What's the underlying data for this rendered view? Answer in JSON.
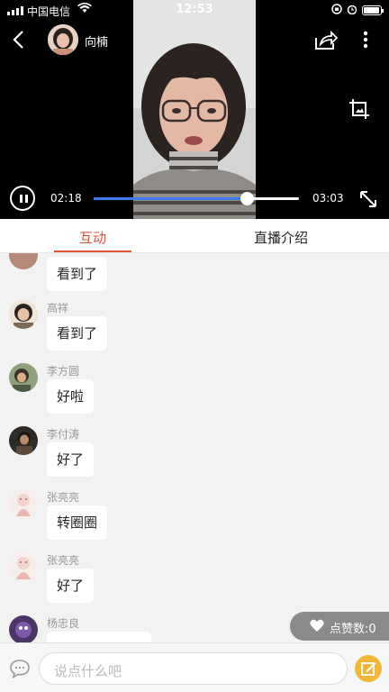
{
  "status_bar": {
    "carrier": "中国电信",
    "time": "12:53"
  },
  "header": {
    "host_name": "向楠"
  },
  "player": {
    "current_time": "02:18",
    "total_time": "03:03",
    "progress": 0.747
  },
  "tabs": [
    {
      "label": "互动",
      "active": true
    },
    {
      "label": "直播介绍",
      "active": false
    }
  ],
  "messages": [
    {
      "name": "",
      "text": "看到了",
      "avatar_color": "#b58a7a"
    },
    {
      "name": "高祥",
      "text": "看到了",
      "avatar_color": "#c9a98a"
    },
    {
      "name": "李方圆",
      "text": "好啦",
      "avatar_color": "#6d7a5e"
    },
    {
      "name": "李付涛",
      "text": "好了",
      "avatar_color": "#2e2a26"
    },
    {
      "name": "张亮亮",
      "text": "转圈圈",
      "avatar_color": "#f3e3e1"
    },
    {
      "name": "张亮亮",
      "text": "好了",
      "avatar_color": "#f3e3e1"
    },
    {
      "name": "杨忠良",
      "text": "",
      "avatar_color": "#5b3f7a"
    }
  ],
  "likes": {
    "label": "点赞数:0"
  },
  "input": {
    "placeholder": "说点什么吧"
  },
  "colors": {
    "accent": "#e0533a",
    "progress": "#3b7bf0",
    "compose": "#f2b63a"
  }
}
